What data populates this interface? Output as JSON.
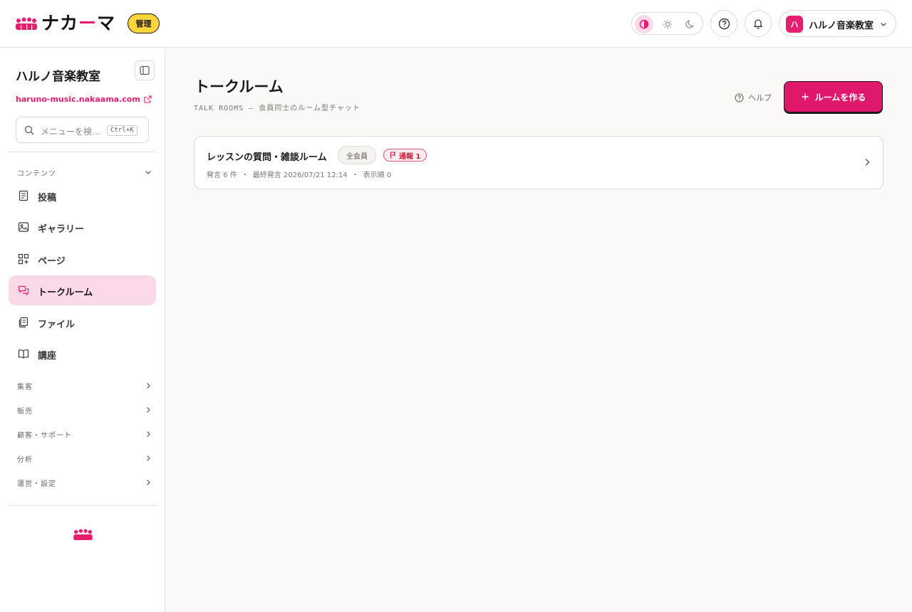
{
  "brand": {
    "logo_text_a": "ナカ",
    "logo_text_b": "ー",
    "logo_text_c": "マ",
    "admin_badge": "管理",
    "accent": "#e61e6e"
  },
  "header": {
    "theme_modes": [
      "contrast-icon",
      "sun-icon",
      "moon-icon"
    ],
    "org_avatar": "ハ",
    "org_name": "ハルノ音楽教室"
  },
  "sidebar": {
    "site_title": "ハルノ音楽教室",
    "site_url": "haruno-music.nakaama.com",
    "search_placeholder": "メニューを検…",
    "search_shortcut": "Ctrl+K",
    "content_section": "コンテンツ",
    "items": [
      {
        "label": "投稿",
        "icon": "document-icon"
      },
      {
        "label": "ギャラリー",
        "icon": "image-icon"
      },
      {
        "label": "ページ",
        "icon": "page-blocks-icon"
      },
      {
        "label": "トークルーム",
        "icon": "chat-icon",
        "active": true
      },
      {
        "label": "ファイル",
        "icon": "files-icon"
      },
      {
        "label": "講座",
        "icon": "book-icon"
      }
    ],
    "sections": [
      "集客",
      "販売",
      "顧客・サポート",
      "分析",
      "運営・設定"
    ]
  },
  "main": {
    "title": "トークルーム",
    "subtitle": "TALK ROOMS — 会員同士のルーム型チャット",
    "help": "ヘルプ",
    "create_button": "ルームを作る",
    "rooms": [
      {
        "name": "レッスンの質問・雑談ルーム",
        "audience": "全会員",
        "report": "通報 1",
        "posts": "発言 6 件",
        "last_post": "最終発言 2026/07/21 12:14",
        "order": "表示順 0"
      }
    ]
  }
}
